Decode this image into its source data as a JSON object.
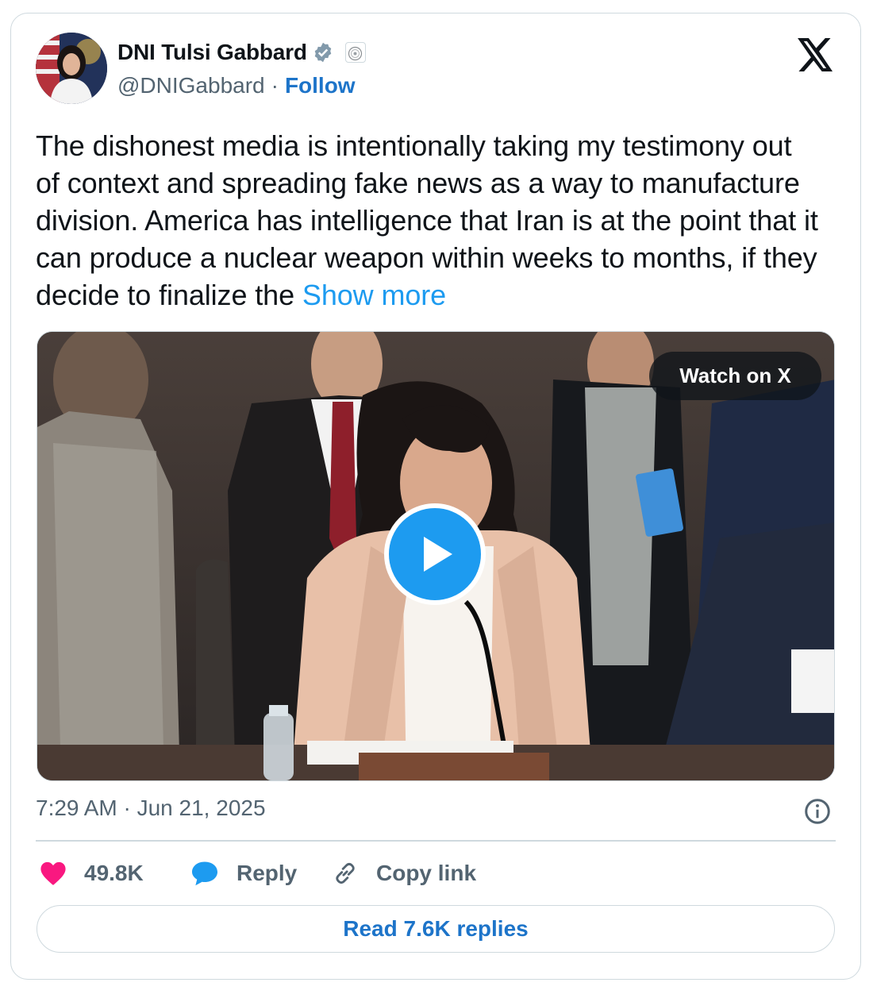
{
  "author": {
    "name": "DNI Tulsi Gabbard",
    "handle": "@DNIGabbard",
    "separator": "·",
    "follow_label": "Follow"
  },
  "icons": {
    "verified": "verified-badge-icon",
    "government": "government-seal-icon",
    "brand": "x-logo-icon",
    "play": "play-icon",
    "info": "info-icon",
    "like": "heart-icon",
    "reply": "reply-bubble-icon",
    "copy": "link-icon"
  },
  "colors": {
    "accent_blue": "#1d9bf0",
    "link_blue": "#1d74c9",
    "like_red": "#f91880",
    "muted_gray": "#536471",
    "border": "#cfd9de"
  },
  "tweet": {
    "text": "The dishonest media is intentionally taking my testimony out of context and spreading fake news as a way to manufacture division. America has intelligence that Iran is at the point that it can produce a nuclear weapon within weeks to months, if they decide to finalize the ",
    "show_more_label": "Show more"
  },
  "media": {
    "watch_label": "Watch on X"
  },
  "timestamp": "7:29 AM · Jun 21, 2025",
  "actions": {
    "likes_count": "49.8K",
    "reply_label": "Reply",
    "copy_link_label": "Copy link"
  },
  "read_replies_label": "Read 7.6K replies"
}
